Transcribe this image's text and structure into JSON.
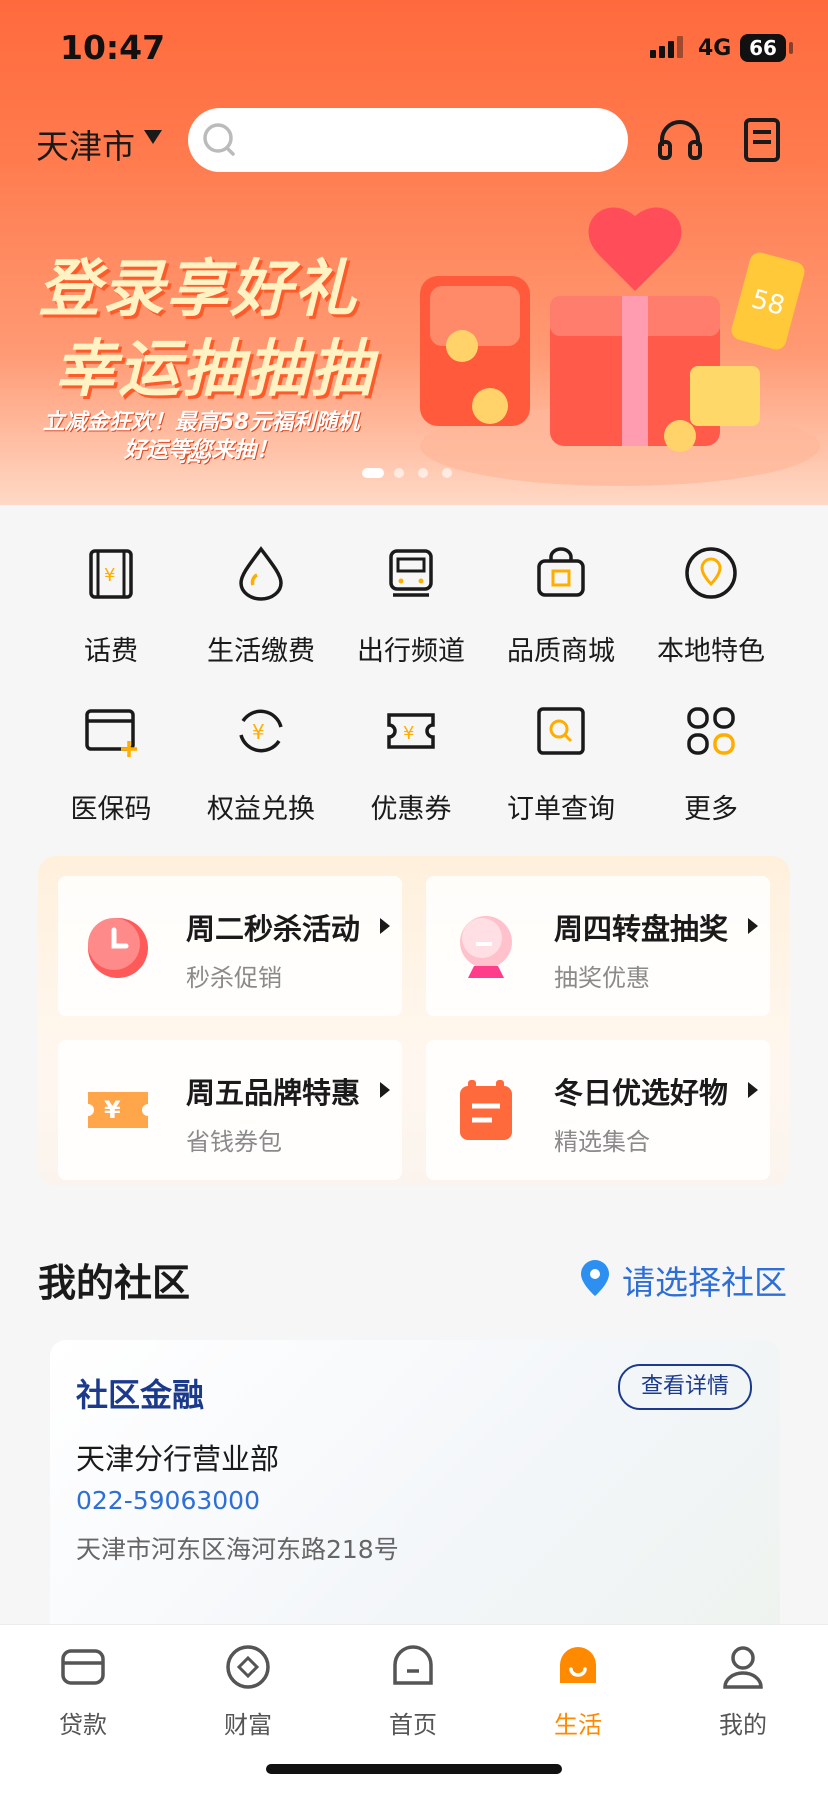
{
  "status_bar": {
    "time": "10:47",
    "network": "4G",
    "battery": "66"
  },
  "header": {
    "city": "天津市",
    "search_placeholder": ""
  },
  "banner": {
    "title_line1": "登录享好礼",
    "title_line2": "幸运抽抽抽",
    "subtitle_line1": "立减金狂欢！最高58元福利随机抽，",
    "subtitle_line2": "好运等您来抽！",
    "slide_count": 4,
    "active_slide": 1
  },
  "quick_menu": [
    {
      "label": "话费",
      "icon": "phone-bill-icon"
    },
    {
      "label": "生活缴费",
      "icon": "utility-drop-icon"
    },
    {
      "label": "出行频道",
      "icon": "train-icon"
    },
    {
      "label": "品质商城",
      "icon": "shopping-bag-icon"
    },
    {
      "label": "本地特色",
      "icon": "location-pin-icon"
    },
    {
      "label": "医保码",
      "icon": "medical-card-icon"
    },
    {
      "label": "权益兑换",
      "icon": "exchange-yuan-icon"
    },
    {
      "label": "优惠券",
      "icon": "coupon-icon"
    },
    {
      "label": "订单查询",
      "icon": "order-search-icon"
    },
    {
      "label": "更多",
      "icon": "more-grid-icon"
    }
  ],
  "promos": [
    {
      "title": "周二秒杀活动",
      "subtitle": "秒杀促销",
      "icon": "clock-icon"
    },
    {
      "title": "周四转盘抽奖",
      "subtitle": "抽奖优惠",
      "icon": "crystal-ball-icon"
    },
    {
      "title": "周五品牌特惠",
      "subtitle": "省钱券包",
      "icon": "yuan-ticket-icon"
    },
    {
      "title": "冬日优选好物",
      "subtitle": "精选集合",
      "icon": "calendar-list-icon"
    }
  ],
  "community": {
    "title": "我的社区",
    "select_link": "请选择社区",
    "card": {
      "title": "社区金融",
      "detail_button": "查看详情",
      "branch_name": "天津分行营业部",
      "phone": "022-59063000",
      "address": "天津市河东区海河东路218号"
    }
  },
  "tabbar": {
    "items": [
      {
        "label": "贷款",
        "icon": "wallet-icon"
      },
      {
        "label": "财富",
        "icon": "diamond-coin-icon"
      },
      {
        "label": "首页",
        "icon": "home-icon"
      },
      {
        "label": "生活",
        "icon": "life-bag-icon"
      },
      {
        "label": "我的",
        "icon": "user-icon"
      }
    ],
    "active": "生活"
  },
  "colors": {
    "brand": "#ff6a3d",
    "active_tab": "#ff8a00",
    "link": "#2d6fd6",
    "community_title": "#1b3a8c"
  }
}
